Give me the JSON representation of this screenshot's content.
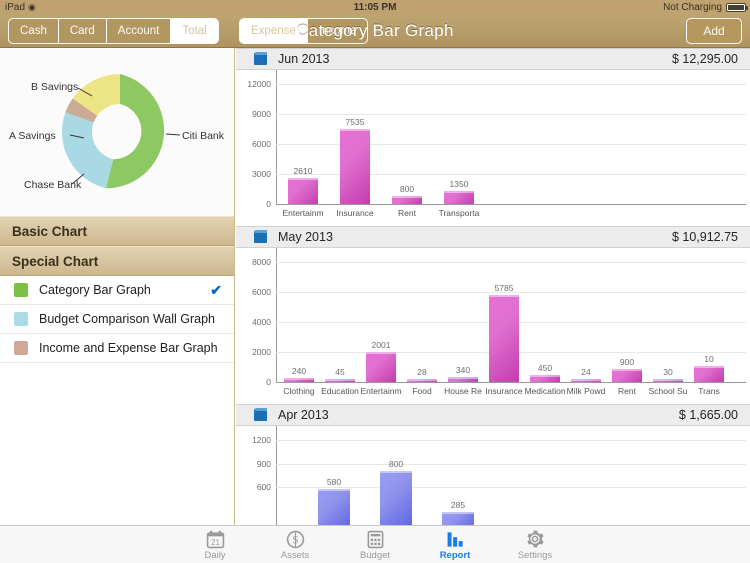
{
  "status_bar": {
    "device": "iPad",
    "wifi_icon": "wifi-icon",
    "time": "11:05 PM",
    "battery_text": "Not Charging",
    "battery_icon": "battery-icon"
  },
  "toolbar": {
    "account_segments": [
      {
        "label": "Cash",
        "active": false
      },
      {
        "label": "Card",
        "active": false
      },
      {
        "label": "Account",
        "active": false
      },
      {
        "label": "Total",
        "active": true
      }
    ],
    "type_segments": [
      {
        "label": "Expense",
        "active": true
      },
      {
        "label": "Income",
        "active": false
      }
    ],
    "title": "Category Bar Graph",
    "add_label": "Add"
  },
  "sidebar": {
    "donut": {
      "segments": [
        {
          "label": "Citi Bank",
          "percent": 54,
          "color": "#8dc861"
        },
        {
          "label": "Chase Bank",
          "percent": 12,
          "color": "#a8d9e4"
        },
        {
          "label": "A Savings",
          "percent": 10,
          "color": "#cbab96"
        },
        {
          "label": "B Savings",
          "percent": 24,
          "color": "#ede585"
        }
      ]
    },
    "group_basic": "Basic Chart",
    "group_special": "Special Chart",
    "chart_items": [
      {
        "label": "Category Bar Graph",
        "color": "#7ac143",
        "selected": true
      },
      {
        "label": "Budget Comparison Wall Graph",
        "color": "#aadce6",
        "selected": false
      },
      {
        "label": "Income and Expense Bar Graph",
        "color": "#cfa995",
        "selected": false
      }
    ],
    "check_glyph": "✔"
  },
  "sections": [
    {
      "title": "Jun 2013",
      "amount": "$ 12,295.00",
      "icon": "book-icon"
    },
    {
      "title": "May 2013",
      "amount": "$ 10,912.75",
      "icon": "book-icon"
    },
    {
      "title": "Apr 2013",
      "amount": "$ 1,665.00",
      "icon": "book-icon"
    }
  ],
  "chart_data": [
    {
      "type": "bar",
      "title": "Jun 2013",
      "total": "$ 12,295.00",
      "categories": [
        "Entertainm",
        "Insurance",
        "Rent",
        "Transporta"
      ],
      "values": [
        2610,
        7535,
        800,
        1350
      ],
      "yticks": [
        0,
        3000,
        6000,
        9000,
        12000
      ],
      "ylim": [
        0,
        12000
      ],
      "xlabel": "",
      "ylabel": "",
      "grid": true,
      "bar_color": "#d95ac6"
    },
    {
      "type": "bar",
      "title": "May 2013",
      "total": "$ 10,912.75",
      "categories": [
        "Clothing",
        "Education",
        "Entertainm",
        "Food",
        "House Re",
        "Insurance",
        "Medication",
        "Milk Powd",
        "Rent",
        "School Su",
        "Trans"
      ],
      "values": [
        240,
        45,
        2001,
        28,
        340,
        5785,
        450,
        24,
        900,
        30,
        1070
      ],
      "value_labels": [
        "240",
        "45",
        "2001",
        "28",
        "340",
        "5785",
        "450",
        "24",
        "900",
        "30",
        "10"
      ],
      "yticks": [
        0,
        2000,
        4000,
        6000,
        8000
      ],
      "ylim": [
        0,
        8000
      ],
      "xlabel": "",
      "ylabel": "",
      "grid": true,
      "bar_color": "#d95ac6"
    },
    {
      "type": "bar",
      "title": "Apr 2013",
      "total": "$ 1,665.00",
      "categories": [
        "",
        "",
        ""
      ],
      "values": [
        580,
        800,
        285
      ],
      "yticks": [
        600,
        900,
        1200
      ],
      "ylim": [
        0,
        1200
      ],
      "xlabel": "",
      "ylabel": "",
      "grid": true,
      "bar_color": "#6a6fe3"
    }
  ],
  "tabbar": {
    "items": [
      {
        "label": "Daily",
        "icon": "calendar-icon",
        "active": false
      },
      {
        "label": "Assets",
        "icon": "dollar-coin-icon",
        "active": false
      },
      {
        "label": "Budget",
        "icon": "calculator-icon",
        "active": false
      },
      {
        "label": "Report",
        "icon": "bar-chart-icon",
        "active": true
      },
      {
        "label": "Settings",
        "icon": "gear-icon",
        "active": false
      }
    ]
  }
}
